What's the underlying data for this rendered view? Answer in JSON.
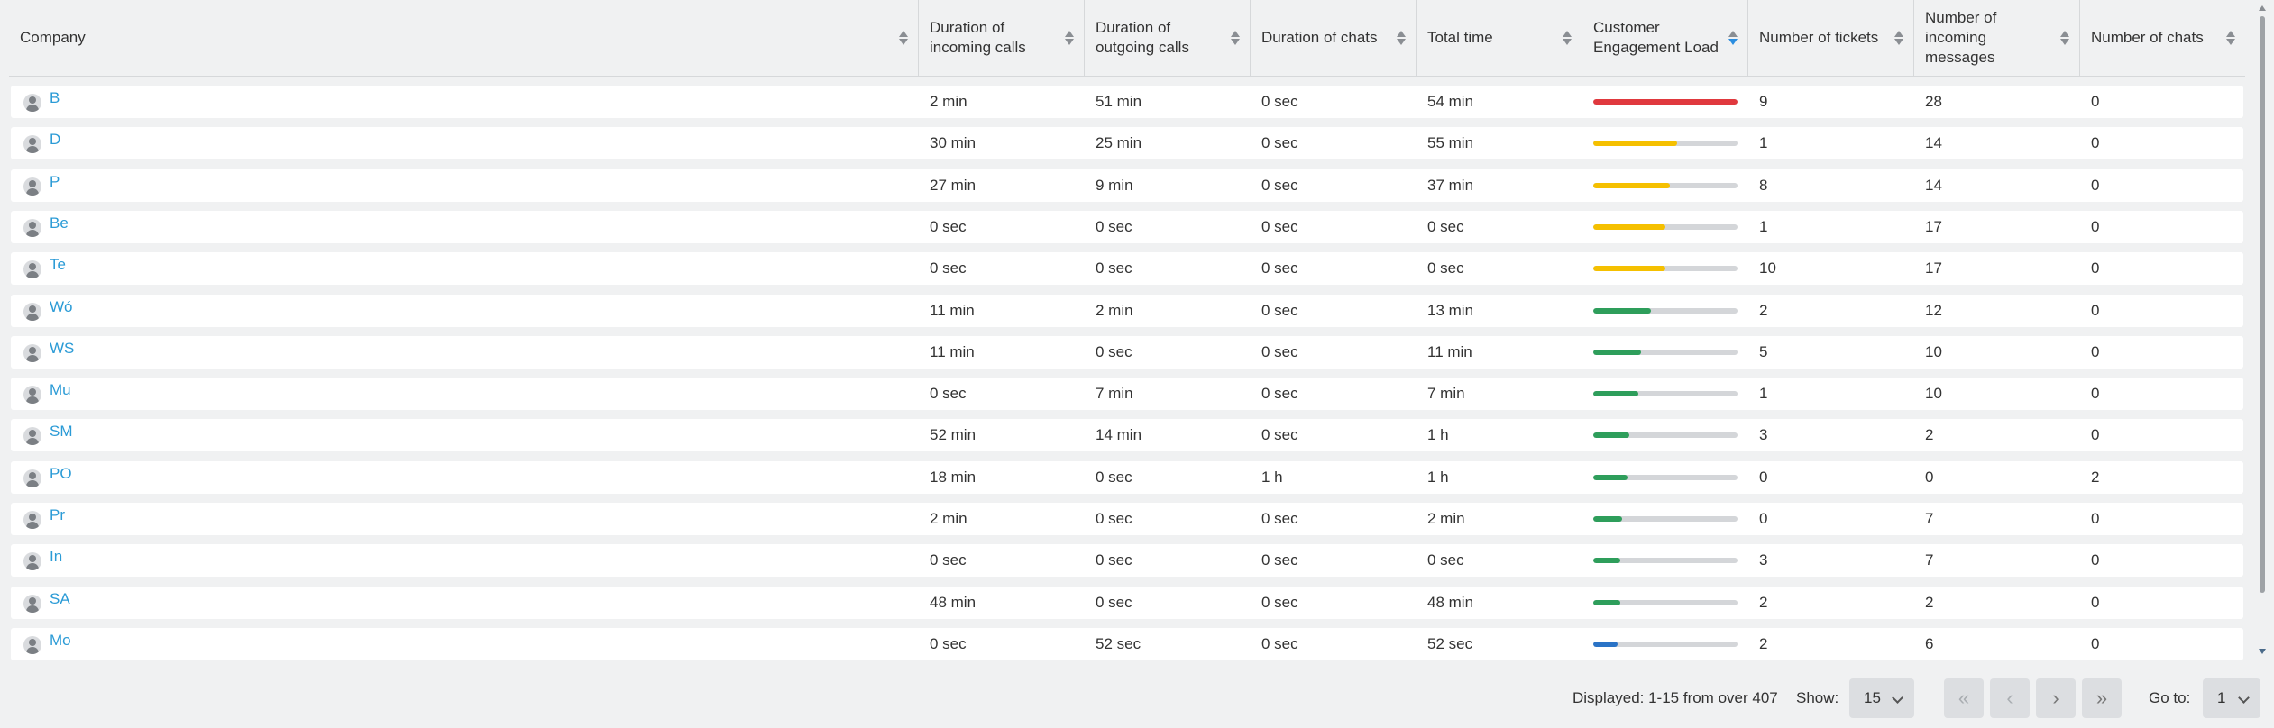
{
  "columns": [
    {
      "label": "Company",
      "sorted": false
    },
    {
      "label": "Duration of incoming calls",
      "sorted": false
    },
    {
      "label": "Duration of outgoing calls",
      "sorted": false
    },
    {
      "label": "Duration of chats",
      "sorted": false
    },
    {
      "label": "Total time",
      "sorted": false
    },
    {
      "label": "Customer Engagement Load",
      "sorted": true
    },
    {
      "label": "Number of tickets",
      "sorted": false
    },
    {
      "label": "Number of incoming messages",
      "sorted": false
    },
    {
      "label": "Number of chats",
      "sorted": false
    }
  ],
  "colors": {
    "red": "#e0393e",
    "yellow": "#f5c000",
    "green": "#2e9e5b",
    "blue": "#2a73c6",
    "link": "#2b9bd6"
  },
  "rows": [
    {
      "company": "B",
      "incoming": "2 min",
      "outgoing": "51 min",
      "chats_dur": "0 sec",
      "total": "54 min",
      "load": 1.0,
      "load_color": "red",
      "tickets": "9",
      "messages": "28",
      "chats": "0"
    },
    {
      "company": "D",
      "incoming": "30 min",
      "outgoing": "25 min",
      "chats_dur": "0 sec",
      "total": "55 min",
      "load": 0.58,
      "load_color": "yellow",
      "tickets": "1",
      "messages": "14",
      "chats": "0"
    },
    {
      "company": "P",
      "incoming": "27 min",
      "outgoing": "9 min",
      "chats_dur": "0 sec",
      "total": "37 min",
      "load": 0.53,
      "load_color": "yellow",
      "tickets": "8",
      "messages": "14",
      "chats": "0"
    },
    {
      "company": "Be",
      "incoming": "0 sec",
      "outgoing": "0 sec",
      "chats_dur": "0 sec",
      "total": "0 sec",
      "load": 0.5,
      "load_color": "yellow",
      "tickets": "1",
      "messages": "17",
      "chats": "0"
    },
    {
      "company": "Te",
      "incoming": "0 sec",
      "outgoing": "0 sec",
      "chats_dur": "0 sec",
      "total": "0 sec",
      "load": 0.5,
      "load_color": "yellow",
      "tickets": "10",
      "messages": "17",
      "chats": "0"
    },
    {
      "company": "Wó",
      "incoming": "11 min",
      "outgoing": "2 min",
      "chats_dur": "0 sec",
      "total": "13 min",
      "load": 0.4,
      "load_color": "green",
      "tickets": "2",
      "messages": "12",
      "chats": "0"
    },
    {
      "company": "WS",
      "incoming": "11 min",
      "outgoing": "0 sec",
      "chats_dur": "0 sec",
      "total": "11 min",
      "load": 0.33,
      "load_color": "green",
      "tickets": "5",
      "messages": "10",
      "chats": "0"
    },
    {
      "company": "Mu",
      "incoming": "0 sec",
      "outgoing": "7 min",
      "chats_dur": "0 sec",
      "total": "7 min",
      "load": 0.31,
      "load_color": "green",
      "tickets": "1",
      "messages": "10",
      "chats": "0"
    },
    {
      "company": "SM",
      "incoming": "52 min",
      "outgoing": "14 min",
      "chats_dur": "0 sec",
      "total": "1 h",
      "load": 0.25,
      "load_color": "green",
      "tickets": "3",
      "messages": "2",
      "chats": "0"
    },
    {
      "company": "PO",
      "incoming": "18 min",
      "outgoing": "0 sec",
      "chats_dur": "1 h",
      "total": "1 h",
      "load": 0.24,
      "load_color": "green",
      "tickets": "0",
      "messages": "0",
      "chats": "2"
    },
    {
      "company": "Pr",
      "incoming": "2 min",
      "outgoing": "0 sec",
      "chats_dur": "0 sec",
      "total": "2 min",
      "load": 0.2,
      "load_color": "green",
      "tickets": "0",
      "messages": "7",
      "chats": "0"
    },
    {
      "company": "In",
      "incoming": "0 sec",
      "outgoing": "0 sec",
      "chats_dur": "0 sec",
      "total": "0 sec",
      "load": 0.19,
      "load_color": "green",
      "tickets": "3",
      "messages": "7",
      "chats": "0"
    },
    {
      "company": "SA",
      "incoming": "48 min",
      "outgoing": "0 sec",
      "chats_dur": "0 sec",
      "total": "48 min",
      "load": 0.19,
      "load_color": "green",
      "tickets": "2",
      "messages": "2",
      "chats": "0"
    },
    {
      "company": "Mo",
      "incoming": "0 sec",
      "outgoing": "52 sec",
      "chats_dur": "0 sec",
      "total": "52 sec",
      "load": 0.17,
      "load_color": "blue",
      "tickets": "2",
      "messages": "6",
      "chats": "0"
    }
  ],
  "footer": {
    "displayed": "Displayed: 1-15 from over 407",
    "show_label": "Show:",
    "page_size": "15",
    "goto_label": "Go to:",
    "page": "1"
  },
  "icons": {
    "first": "double-chevron-left-icon",
    "prev": "chevron-left-icon",
    "next": "chevron-right-icon",
    "last": "double-chevron-right-icon"
  }
}
